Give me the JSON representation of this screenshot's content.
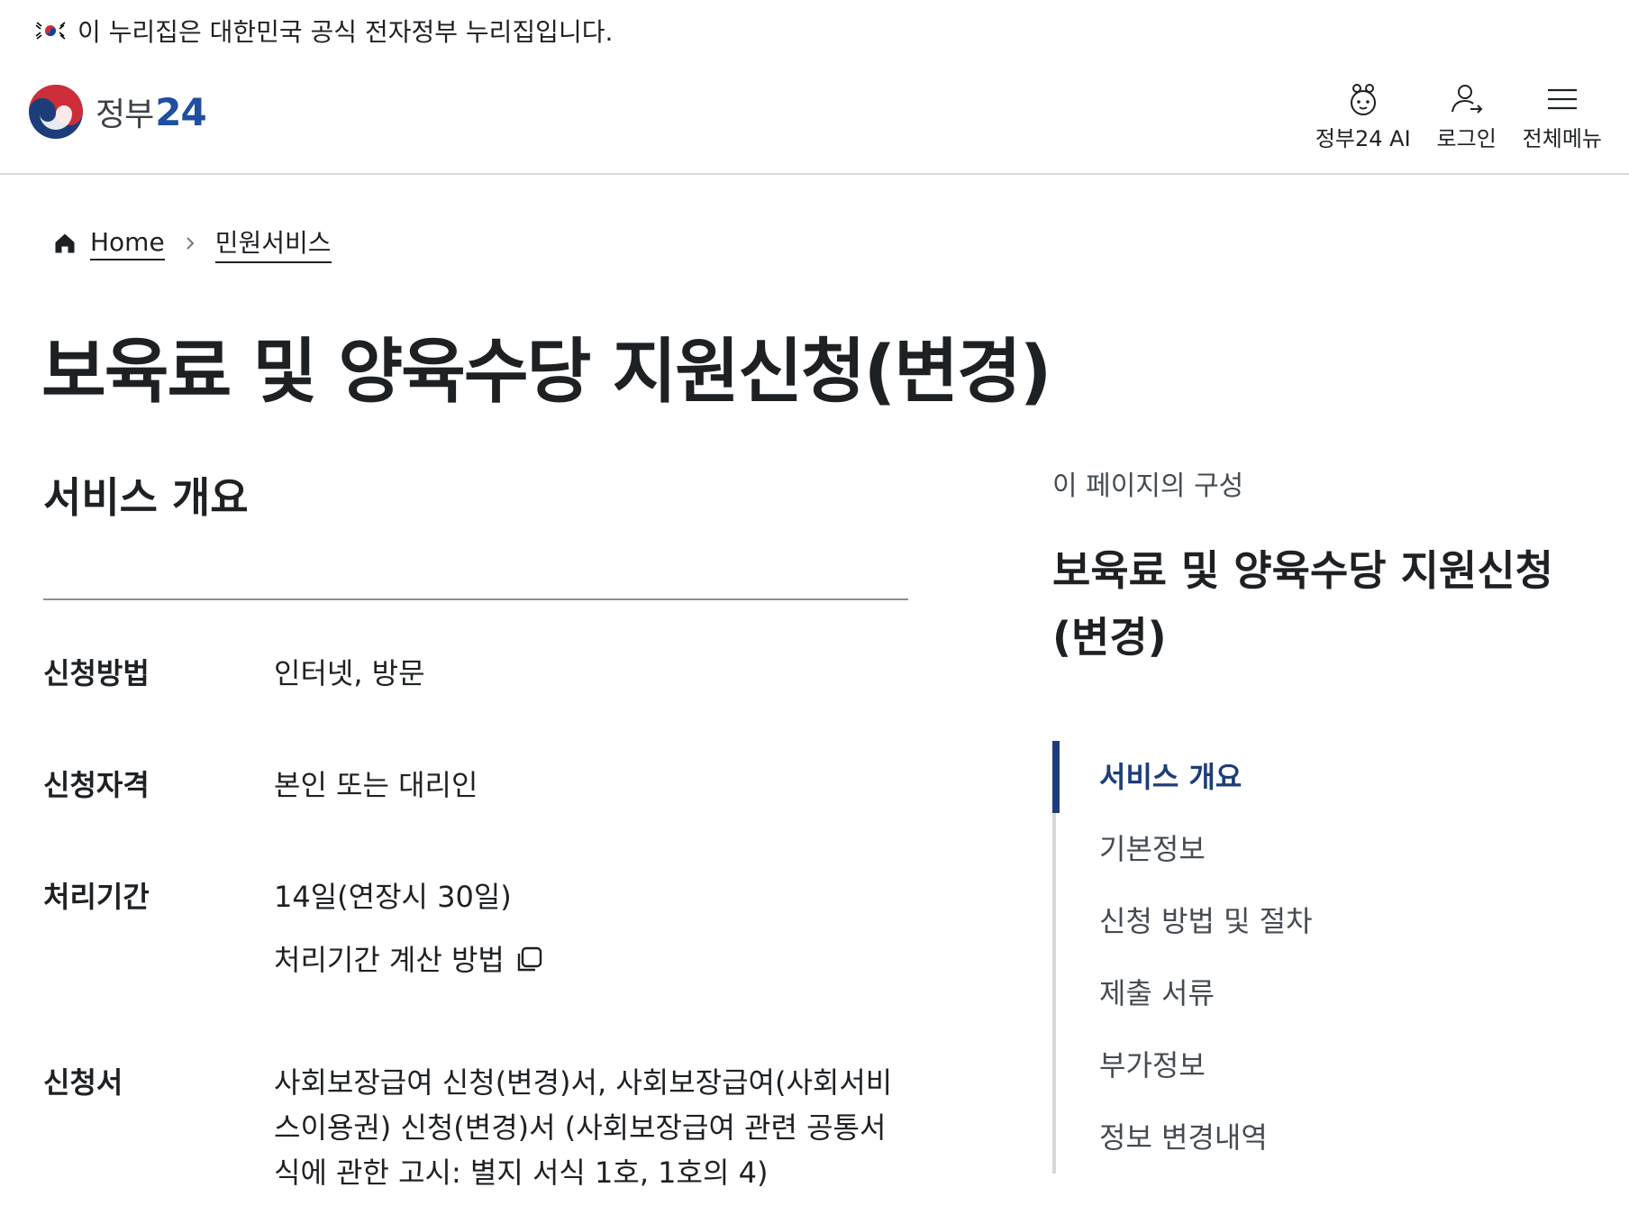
{
  "banner": {
    "text": "이 누리집은 대한민국 공식 전자정부 누리집입니다."
  },
  "header": {
    "logo_text": "정부",
    "logo_num": "24",
    "utility": [
      {
        "label": "정부24 AI",
        "icon": "ai-character-icon"
      },
      {
        "label": "로그인",
        "icon": "user-login-icon"
      },
      {
        "label": "전체메뉴",
        "icon": "hamburger-menu-icon"
      }
    ]
  },
  "breadcrumb": {
    "home": "Home",
    "current": "민원서비스"
  },
  "page_title": "보육료 및 양육수당 지원신청(변경)",
  "overview": {
    "title": "서비스 개요",
    "rows": [
      {
        "label": "신청방법",
        "value": "인터넷, 방문"
      },
      {
        "label": "신청자격",
        "value": "본인 또는 대리인"
      },
      {
        "label": "처리기간",
        "value": "14일(연장시 30일)",
        "link": "처리기간 계산 방법"
      },
      {
        "label": "신청서",
        "value": "사회보장급여 신청(변경)서, 사회보장급여(사회서비스이용권) 신청(변경)서 (사회보장급여 관련 공통서식에 관한 고시: 별지 서식 1호, 1호의 4)"
      }
    ]
  },
  "toc": {
    "caption": "이 페이지의 구성",
    "title": "보육료 및 양육수당 지원신청(변경)",
    "items": [
      {
        "label": "서비스 개요",
        "active": true
      },
      {
        "label": "기본정보"
      },
      {
        "label": "신청 방법 및 절차"
      },
      {
        "label": "제출 서류"
      },
      {
        "label": "부가정보"
      },
      {
        "label": "정보 변경내역"
      }
    ]
  },
  "colors": {
    "primary": "#1d3d7a",
    "text": "#1e2124",
    "muted": "#464c53",
    "border": "#d6d8db"
  }
}
